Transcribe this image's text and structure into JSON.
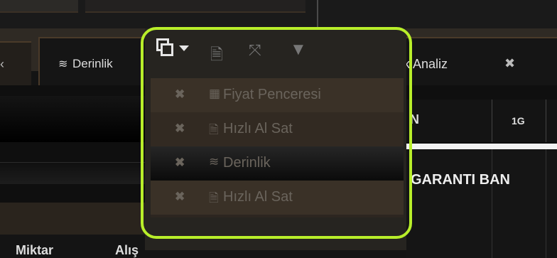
{
  "colors": {
    "highlight": "#b8ee2a",
    "bg": "#141414",
    "tab_border": "#4a3a29",
    "menu_item_bg": "#3a3127"
  },
  "tabs": {
    "left_arrow_icon": "chevron-left-icon",
    "derinlik": {
      "label": "Derinlik",
      "icon": "layers-icon"
    },
    "teknik": {
      "label": "Teknik Analiz",
      "icon": "chart-icon",
      "close": "✖"
    }
  },
  "popup": {
    "toolbar": {
      "window_icon": "windows-dropdown-icon",
      "download_icon": "file-download-icon",
      "expand_icon": "expand-icon",
      "filter_icon": "filter-icon"
    },
    "items": [
      {
        "label": "Fiyat Penceresi",
        "icon": "calculator-icon",
        "close": "✖"
      },
      {
        "label": "Hızlı Al Sat",
        "icon": "document-icon",
        "close": "✖"
      },
      {
        "label": "Derinlik",
        "icon": "layers-icon",
        "close": "✖"
      },
      {
        "label": "Hızlı Al Sat",
        "icon": "document-icon",
        "close": "✖"
      }
    ]
  },
  "left_panel": {
    "columns": [
      "Miktar",
      "Alış"
    ]
  },
  "right_panel": {
    "header_col1": "N",
    "header_col2": "1G",
    "row1_name": "GARANTI BAN"
  }
}
